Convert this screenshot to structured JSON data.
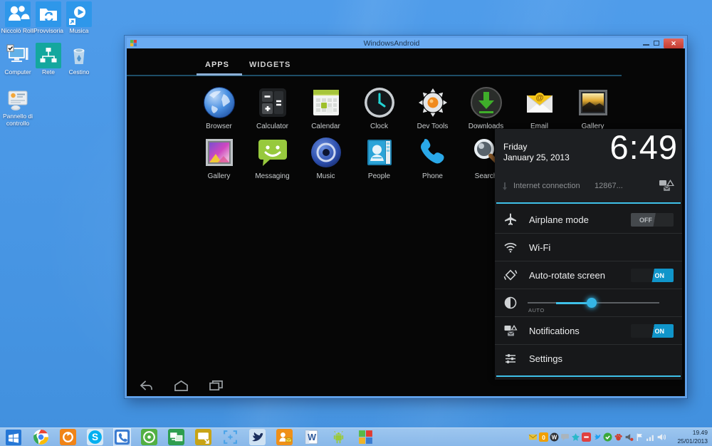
{
  "desktop": {
    "icons": [
      {
        "key": "user",
        "label": "Niccolò Rolli"
      },
      {
        "key": "folder-sync",
        "label": "Provvisoria"
      },
      {
        "key": "music",
        "label": "Musica"
      },
      {
        "key": "computer",
        "label": "Computer"
      },
      {
        "key": "network",
        "label": "Rete"
      },
      {
        "key": "recycle-bin",
        "label": "Cestino"
      },
      {
        "key": "control-panel",
        "label": "Pannello di controllo"
      }
    ]
  },
  "window": {
    "title": "WindowsAndroid",
    "tabs": [
      {
        "label": "APPS",
        "active": true
      },
      {
        "label": "WIDGETS",
        "active": false
      }
    ],
    "apps": [
      {
        "key": "browser",
        "label": "Browser",
        "row": 1
      },
      {
        "key": "calculator",
        "label": "Calculator",
        "row": 1
      },
      {
        "key": "calendar",
        "label": "Calendar",
        "row": 1
      },
      {
        "key": "clock",
        "label": "Clock",
        "row": 1
      },
      {
        "key": "devtools",
        "label": "Dev Tools",
        "row": 1
      },
      {
        "key": "downloads",
        "label": "Downloads",
        "row": 1
      },
      {
        "key": "email",
        "label": "Email",
        "row": 1
      },
      {
        "key": "gallery-dark",
        "label": "Gallery",
        "row": 1
      },
      {
        "key": "gallery-light",
        "label": "Gallery",
        "row": 2
      },
      {
        "key": "messaging",
        "label": "Messaging",
        "row": 2
      },
      {
        "key": "music-app",
        "label": "Music",
        "row": 2
      },
      {
        "key": "people",
        "label": "People",
        "row": 2
      },
      {
        "key": "phone",
        "label": "Phone",
        "row": 2
      },
      {
        "key": "search",
        "label": "Search",
        "row": 2
      }
    ],
    "nav": [
      {
        "key": "back"
      },
      {
        "key": "home"
      },
      {
        "key": "recents"
      }
    ]
  },
  "panel": {
    "day": "Friday",
    "date": "January 25, 2013",
    "time": "6:49",
    "notification": {
      "label": "Internet connection",
      "value": "12867..."
    },
    "rows": [
      {
        "key": "airplane",
        "label": "Airplane mode",
        "toggle": "OFF"
      },
      {
        "key": "wifi",
        "label": "Wi-Fi"
      },
      {
        "key": "rotate",
        "label": "Auto-rotate screen",
        "toggle": "ON"
      },
      {
        "key": "brightness",
        "label": "AUTO",
        "type": "slider",
        "value_pct": 45
      },
      {
        "key": "notifications",
        "label": "Notifications",
        "toggle": "ON"
      },
      {
        "key": "settings",
        "label": "Settings"
      }
    ]
  },
  "taskbar": {
    "start_label": "Start",
    "apps": [
      "chrome",
      "media-orange",
      "skype",
      "phone-app",
      "voice-green",
      "remote-monitors",
      "screen-share",
      "screen-capture",
      "twitter",
      "outlook",
      "word",
      "android",
      "windowsandroid"
    ],
    "active_app": "phone-app",
    "tray": [
      "mail",
      "counter",
      "media-disc",
      "chat-bubble",
      "messenger",
      "recorder",
      "twitter-tray",
      "antivirus",
      "paw",
      "volume-mixer",
      "action-flag",
      "network-signal",
      "speaker"
    ],
    "clock": {
      "time": "19.49",
      "date": "25/01/2013"
    }
  },
  "colors": {
    "accent_blue": "#3fc1e9",
    "toggle_on": "#1095ca",
    "titlebar": "#6aabf2",
    "taskbar": "#94bee8",
    "desktop": "#4796e3"
  }
}
